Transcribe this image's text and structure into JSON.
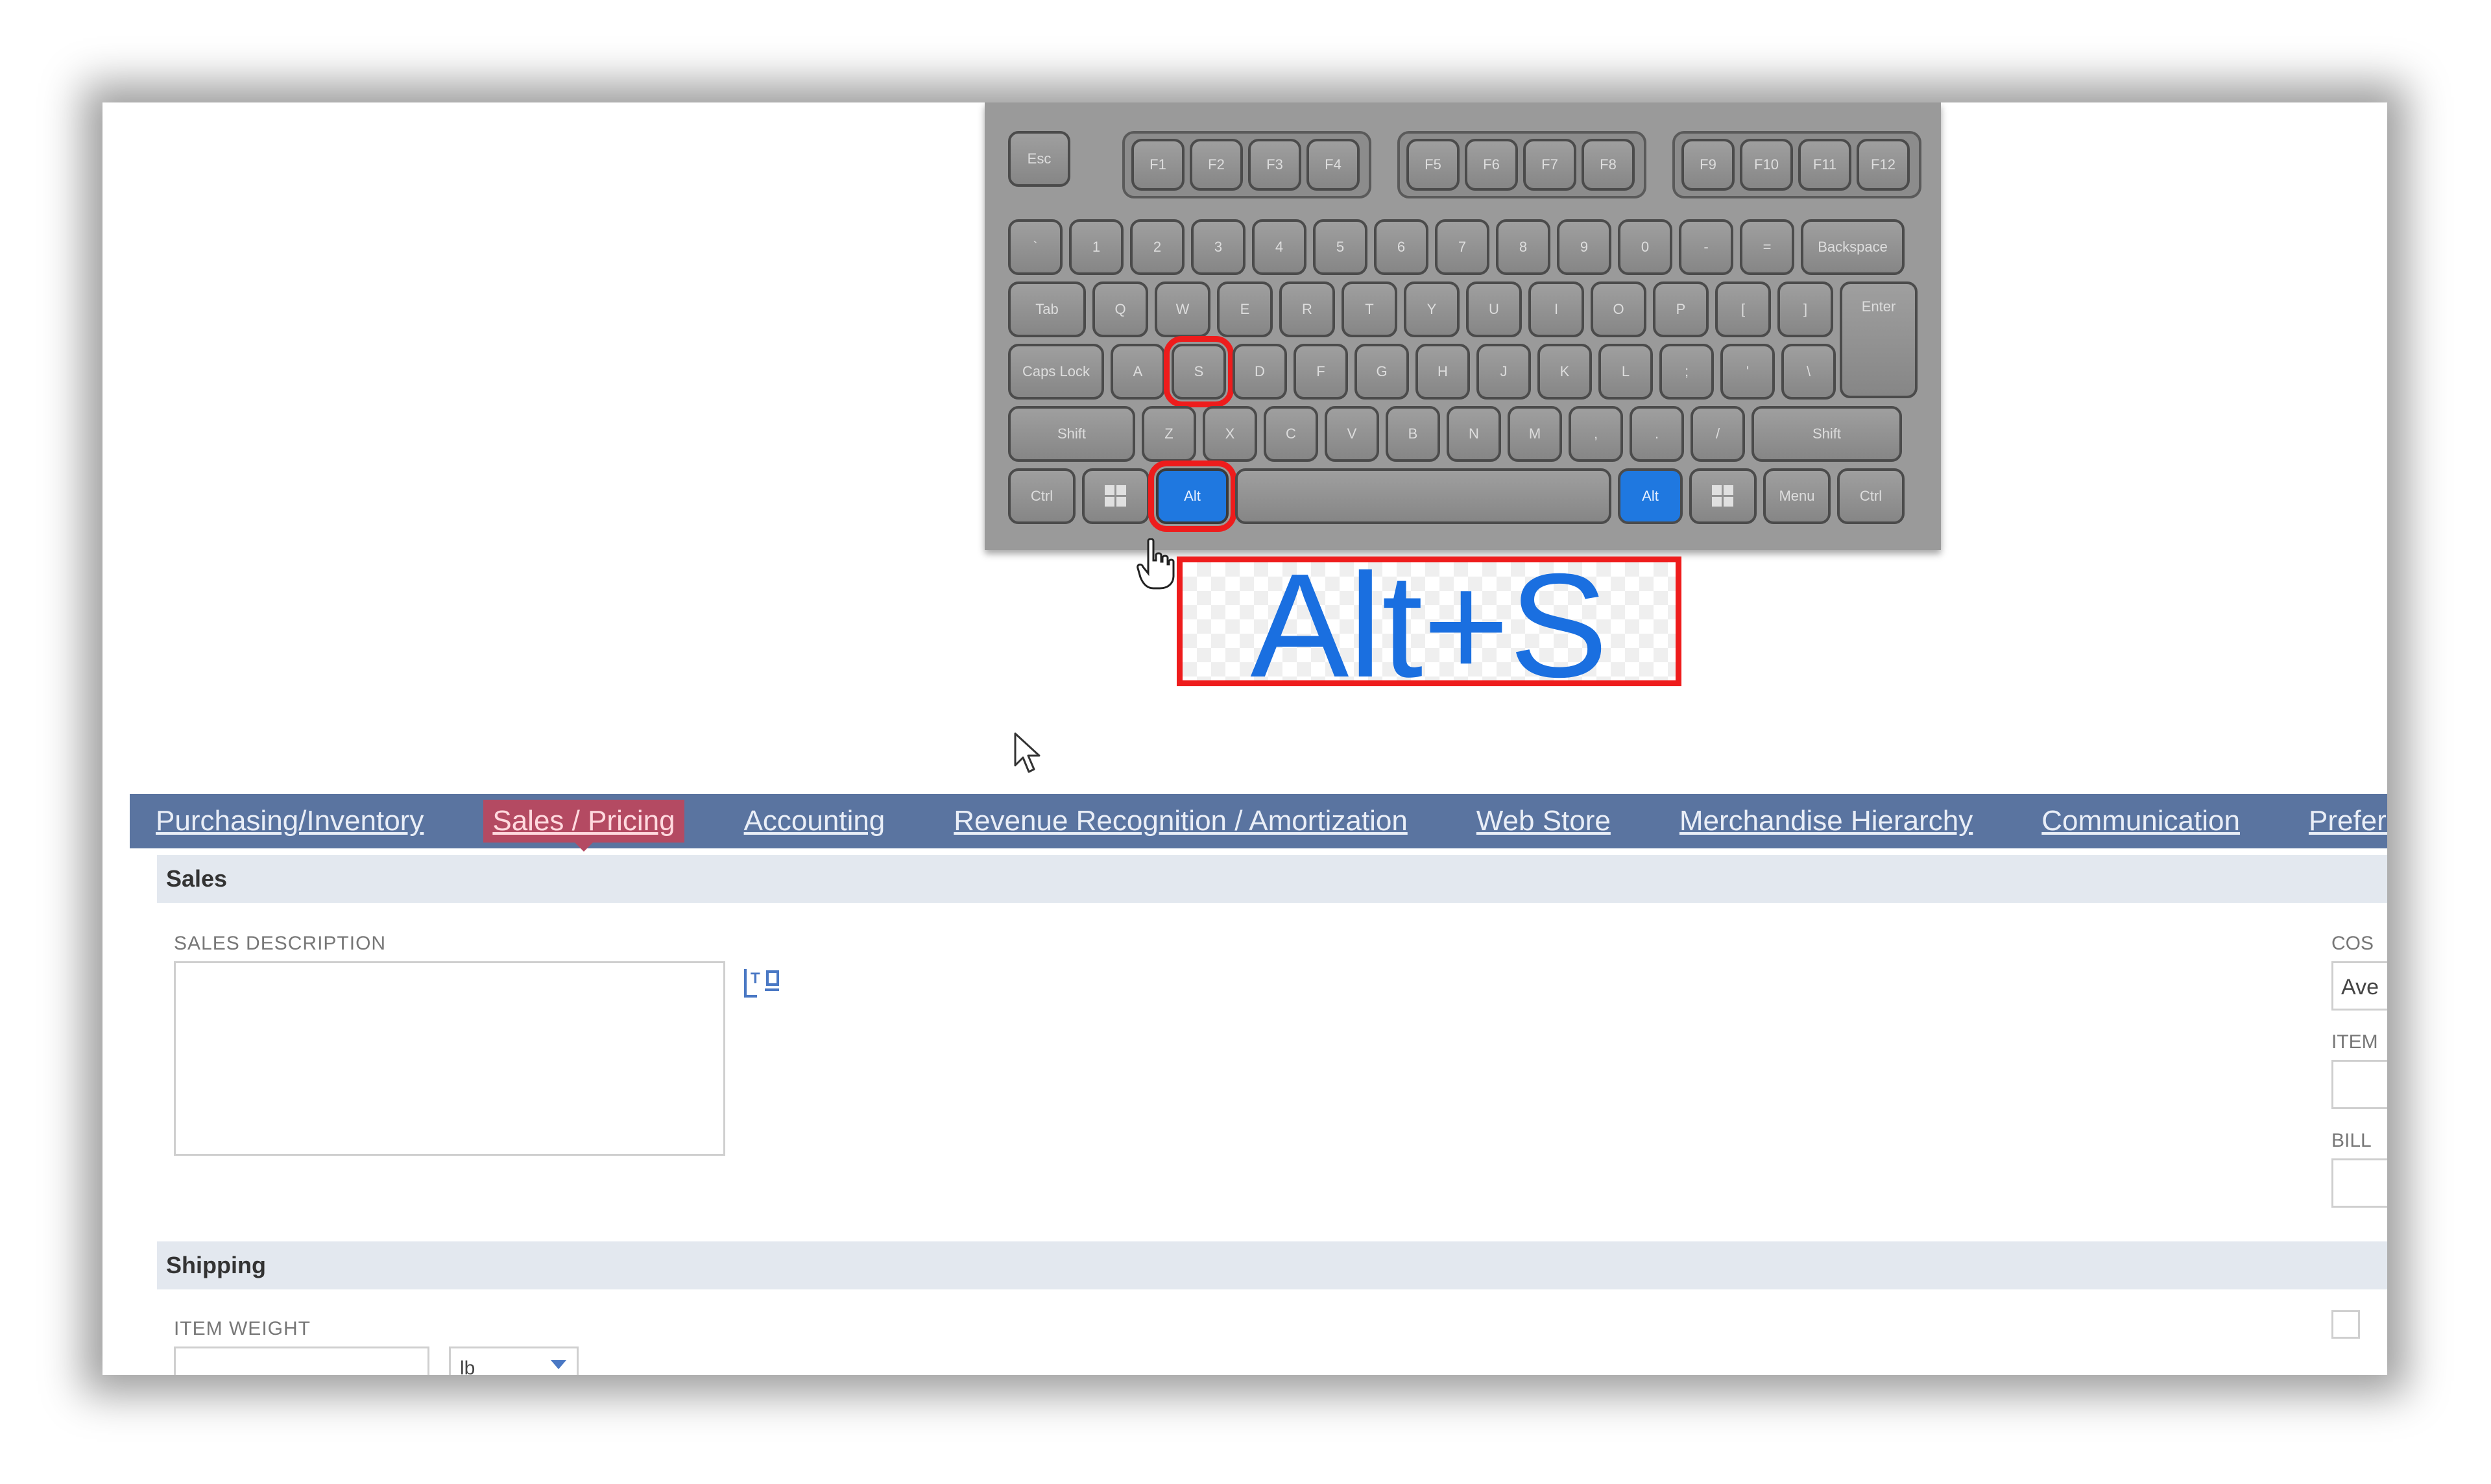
{
  "shortcut": {
    "label": "Alt+S"
  },
  "keyboard": {
    "fn_groups": [
      [
        "F1",
        "F2",
        "F3",
        "F4"
      ],
      [
        "F5",
        "F6",
        "F7",
        "F8"
      ],
      [
        "F9",
        "F10",
        "F11",
        "F12"
      ]
    ],
    "esc": "Esc",
    "number_row": [
      "`",
      "1",
      "2",
      "3",
      "4",
      "5",
      "6",
      "7",
      "8",
      "9",
      "0",
      "-",
      "="
    ],
    "backspace": "Backspace",
    "tab_key": "Tab",
    "top_row": [
      "Q",
      "W",
      "E",
      "R",
      "T",
      "Y",
      "U",
      "I",
      "O",
      "P",
      "[",
      "]"
    ],
    "enter": "Enter",
    "caps": "Caps Lock",
    "home_row": [
      "A",
      "S",
      "D",
      "F",
      "G",
      "H",
      "J",
      "K",
      "L",
      ";",
      "'",
      "\\"
    ],
    "shift_left": "Shift",
    "bottom_row": [
      "Z",
      "X",
      "C",
      "V",
      "B",
      "N",
      "M",
      ",",
      ".",
      "/"
    ],
    "shift_right": "Shift",
    "ctrl_left": "Ctrl",
    "alt_left": "Alt",
    "alt_right": "Alt",
    "menu": "Menu",
    "ctrl_right": "Ctrl",
    "highlight_color": "#ee1c1c",
    "pressed_color": "#1f78e0"
  },
  "tabs": [
    {
      "label": "Purchasing/Inventory",
      "active": false
    },
    {
      "label": "Sales / Pricing",
      "active": true
    },
    {
      "label": "Accounting",
      "active": false
    },
    {
      "label": "Revenue Recognition / Amortization",
      "active": false
    },
    {
      "label": "Web Store",
      "active": false
    },
    {
      "label": "Merchandise Hierarchy",
      "active": false
    },
    {
      "label": "Communication",
      "active": false
    },
    {
      "label": "Preferences",
      "active": false
    }
  ],
  "sales": {
    "heading": "Sales",
    "description_label": "SALES DESCRIPTION",
    "description_value": ""
  },
  "right_column": {
    "cost_label": "COS",
    "cost_value": "Ave",
    "item_label": "ITEM",
    "bill_label": "BILL"
  },
  "shipping": {
    "heading": "Shipping",
    "item_weight_label": "ITEM WEIGHT",
    "weight_unit": "lb"
  }
}
